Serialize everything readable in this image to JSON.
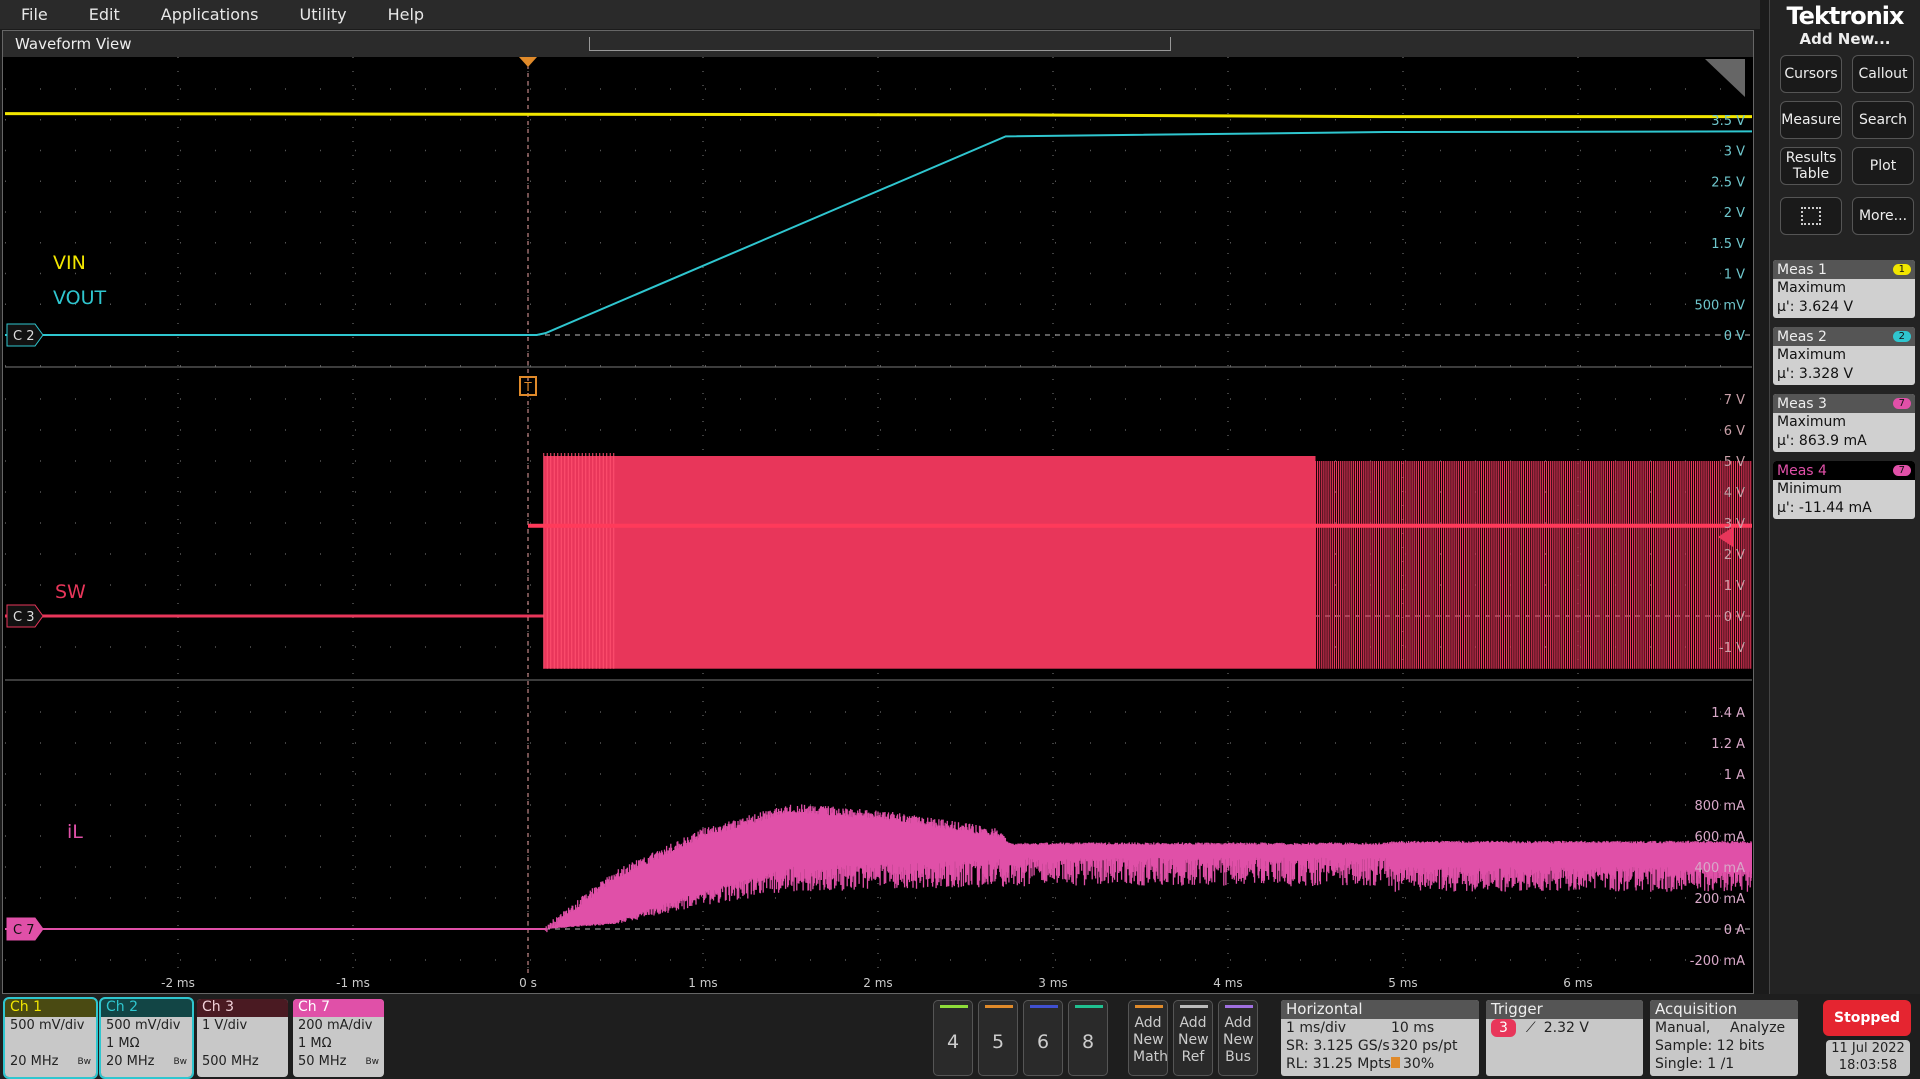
{
  "menu": [
    "File",
    "Edit",
    "Applications",
    "Utility",
    "Help"
  ],
  "waveform_view": {
    "title": "Waveform View",
    "trigger_marker": "T"
  },
  "labels": {
    "vin": "VIN",
    "vout": "VOUT",
    "sw": "SW",
    "il": "iL",
    "c2": "C 2",
    "c3": "C 3",
    "c7": "C 7"
  },
  "axes": {
    "x_ticks": [
      "-2 ms",
      "-1 ms",
      "0 s",
      "1 ms",
      "2 ms",
      "3 ms",
      "4 ms",
      "5 ms",
      "6 ms"
    ],
    "x_tick_values_ms": [
      -2,
      -1,
      0,
      1,
      2,
      3,
      4,
      5,
      6
    ],
    "panel1_ticks": [
      "3.5 V",
      "3 V",
      "2.5 V",
      "2 V",
      "1.5 V",
      "1 V",
      "500 mV",
      "0 V"
    ],
    "panel1_values": [
      3.5,
      3,
      2.5,
      2,
      1.5,
      1,
      0.5,
      0
    ],
    "panel2_ticks": [
      "7 V",
      "6 V",
      "5 V",
      "4 V",
      "3 V",
      "2 V",
      "1 V",
      "0 V",
      "-1 V"
    ],
    "panel2_values": [
      7,
      6,
      5,
      4,
      3,
      2,
      1,
      0,
      -1
    ],
    "panel3_ticks": [
      "1.4 A",
      "1.2 A",
      "1 A",
      "800 mA",
      "600 mA",
      "400 mA",
      "200 mA",
      "0 A",
      "-200 mA"
    ],
    "panel3_values": [
      1.4,
      1.2,
      1,
      0.8,
      0.6,
      0.4,
      0.2,
      0,
      -0.2
    ]
  },
  "traces": {
    "vin": {
      "color": "#f2e600",
      "points_ms_v": [
        [
          -3,
          3.6
        ],
        [
          2.7,
          3.58
        ],
        [
          4.9,
          3.55
        ],
        [
          7,
          3.55
        ]
      ]
    },
    "vout": {
      "color": "#2fc6cf",
      "points_ms_v": [
        [
          -3,
          0
        ],
        [
          0.05,
          0
        ],
        [
          0.1,
          0.03
        ],
        [
          2.73,
          3.23
        ],
        [
          4.9,
          3.3
        ],
        [
          7,
          3.31
        ]
      ]
    },
    "sw": {
      "color": "#e8365a",
      "start_ms": 0.09,
      "high_v": 5,
      "low_v": -1.7,
      "band_v": 3.3
    },
    "il": {
      "color": "#e050a8",
      "envelope_ms_a": [
        [
          0.1,
          0,
          0
        ],
        [
          0.5,
          0.35,
          0.05
        ],
        [
          1,
          0.62,
          0.25
        ],
        [
          1.5,
          0.78,
          0.4
        ],
        [
          2,
          0.74,
          0.42
        ],
        [
          2.7,
          0.62,
          0.45
        ],
        [
          2.75,
          0.55,
          0.46
        ],
        [
          4.9,
          0.55,
          0.46
        ],
        [
          4.95,
          0.56,
          0.4
        ],
        [
          7,
          0.56,
          0.4
        ]
      ]
    }
  },
  "right_panel": {
    "brand": "Tektronix",
    "add_new": "Add New...",
    "buttons": [
      "Cursors",
      "Callout",
      "Measure",
      "Search",
      "Results Table",
      "Plot",
      "More..."
    ],
    "measurements": [
      {
        "title": "Meas 1",
        "badge": "1",
        "badge_color": "#f2e600",
        "type": "Maximum",
        "value": "µ': 3.624 V"
      },
      {
        "title": "Meas 2",
        "badge": "2",
        "badge_color": "#2fc6cf",
        "type": "Maximum",
        "value": "µ': 3.328 V"
      },
      {
        "title": "Meas 3",
        "badge": "7",
        "badge_color": "#e050a8",
        "type": "Maximum",
        "value": "µ': 863.9 mA"
      },
      {
        "title": "Meas 4",
        "badge": "7",
        "badge_color": "#e050a8",
        "type": "Minimum",
        "value": "µ': -11.44 mA"
      }
    ]
  },
  "channels": [
    {
      "name": "Ch 1",
      "l1": "500 mV/div",
      "l2": "",
      "l3": "20 MHz",
      "bw": "Bw",
      "color": "#f2e600",
      "hdbg": "#4a4a12"
    },
    {
      "name": "Ch 2",
      "l1": "500 mV/div",
      "l2": "1 MΩ",
      "l3": "20 MHz",
      "bw": "Bw",
      "color": "#2fc6cf",
      "hdbg": "#124545"
    },
    {
      "name": "Ch 3",
      "l1": "1 V/div",
      "l2": "",
      "l3": "500 MHz",
      "bw": "",
      "color": "#f0d0d8",
      "hdbg": "#4a1a22"
    },
    {
      "name": "Ch 7",
      "l1": "200 mA/div",
      "l2": "1 MΩ",
      "l3": "50 MHz",
      "bw": "Bw",
      "color": "#fff",
      "hdbg": "#e050a8"
    }
  ],
  "slots": [
    "4",
    "5",
    "6",
    "8"
  ],
  "add_buttons": [
    "Add New Math",
    "Add New Ref",
    "Add New Bus"
  ],
  "horizontal": {
    "title": "Horizontal",
    "scale": "1 ms/div",
    "duration": "10 ms",
    "sr": "SR: 3.125 GS/s",
    "res": "320 ps/pt",
    "rl": "RL: 31.25 Mpts",
    "pos": "30%"
  },
  "trigger": {
    "title": "Trigger",
    "source": "3",
    "level": "2.32 V"
  },
  "acquisition": {
    "title": "Acquisition",
    "mode": "Manual,",
    "analyze": "Analyze",
    "sample": "Sample: 12 bits",
    "single": "Single: 1 /1"
  },
  "status": {
    "run": "Stopped",
    "date": "11 Jul 2022",
    "time": "18:03:58"
  }
}
